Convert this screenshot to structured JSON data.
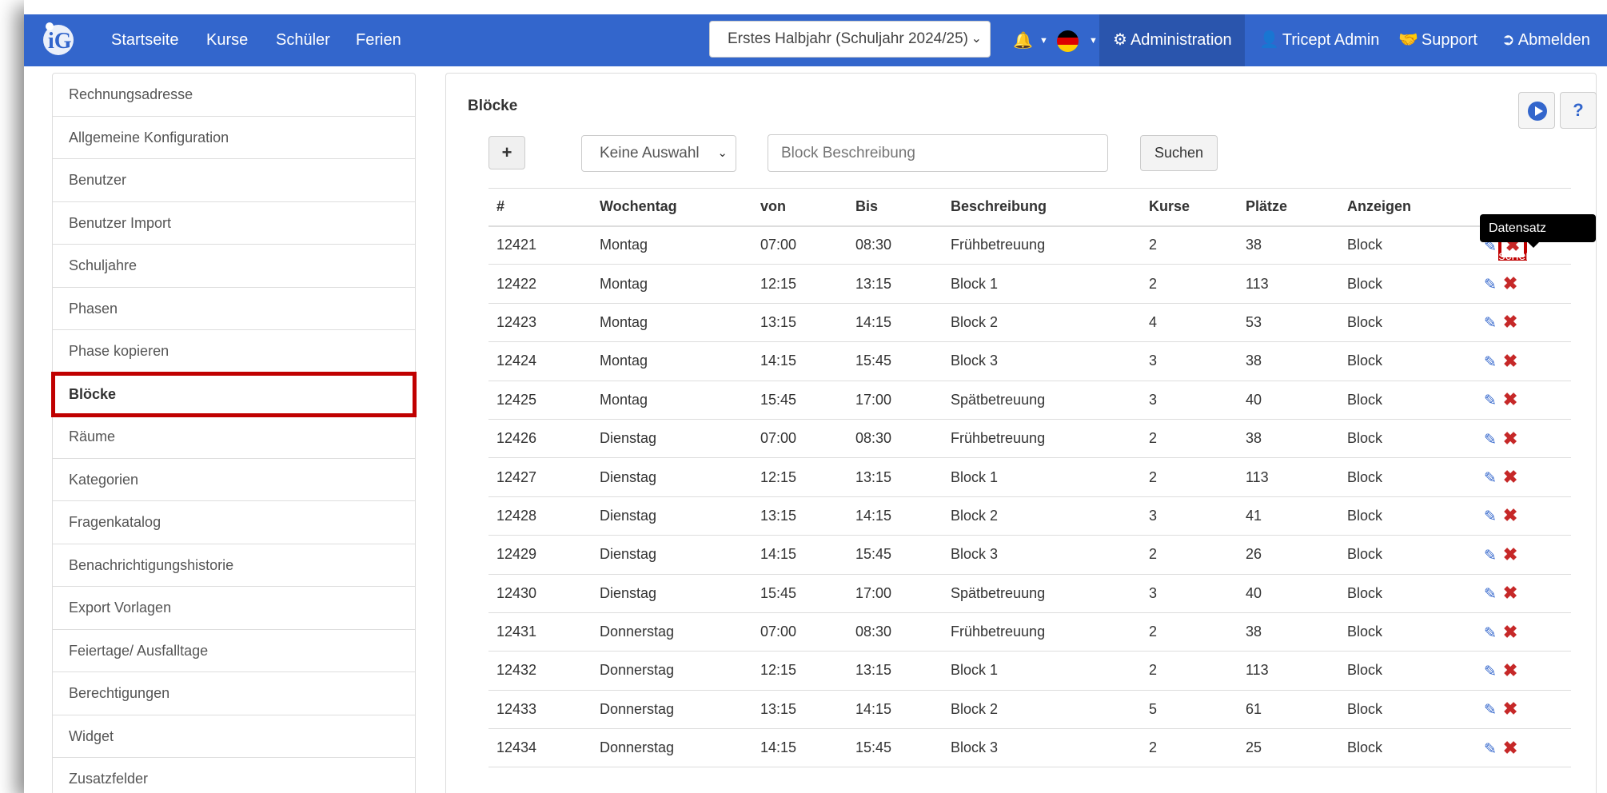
{
  "nav": {
    "links": [
      "Startseite",
      "Kurse",
      "Schüler",
      "Ferien"
    ],
    "term_select": "Erstes Halbjahr (Schuljahr 2024/25)",
    "administration": "Administration",
    "user": "Tricept Admin",
    "support": "Support",
    "logout": "Abmelden"
  },
  "sidebar": {
    "items": [
      "Rechnungsadresse",
      "Allgemeine Konfiguration",
      "Benutzer",
      "Benutzer Import",
      "Schuljahre",
      "Phasen",
      "Phase kopieren",
      "Blöcke",
      "Räume",
      "Kategorien",
      "Fragenkatalog",
      "Benachrichtigungshistorie",
      "Export Vorlagen",
      "Feiertage/ Ausfalltage",
      "Berechtigungen",
      "Widget",
      "Zusatzfelder"
    ],
    "active_index": 7
  },
  "main": {
    "title": "Blöcke",
    "add_label": "+",
    "filter_select": "Keine Auswahl",
    "search_placeholder": "Block Beschreibung",
    "search_button": "Suchen",
    "help_label": "?",
    "tooltip": "Datensatz löschen",
    "columns": [
      "#",
      "Wochentag",
      "von",
      "Bis",
      "Beschreibung",
      "Kurse",
      "Plätze",
      "Anzeigen",
      ""
    ],
    "rows": [
      [
        "12421",
        "Montag",
        "07:00",
        "08:30",
        "Frühbetreuung",
        "2",
        "38",
        "Block"
      ],
      [
        "12422",
        "Montag",
        "12:15",
        "13:15",
        "Block 1",
        "2",
        "113",
        "Block"
      ],
      [
        "12423",
        "Montag",
        "13:15",
        "14:15",
        "Block 2",
        "4",
        "53",
        "Block"
      ],
      [
        "12424",
        "Montag",
        "14:15",
        "15:45",
        "Block 3",
        "3",
        "38",
        "Block"
      ],
      [
        "12425",
        "Montag",
        "15:45",
        "17:00",
        "Spätbetreuung",
        "3",
        "40",
        "Block"
      ],
      [
        "12426",
        "Dienstag",
        "07:00",
        "08:30",
        "Frühbetreuung",
        "2",
        "38",
        "Block"
      ],
      [
        "12427",
        "Dienstag",
        "12:15",
        "13:15",
        "Block 1",
        "2",
        "113",
        "Block"
      ],
      [
        "12428",
        "Dienstag",
        "13:15",
        "14:15",
        "Block 2",
        "3",
        "41",
        "Block"
      ],
      [
        "12429",
        "Dienstag",
        "14:15",
        "15:45",
        "Block 3",
        "2",
        "26",
        "Block"
      ],
      [
        "12430",
        "Dienstag",
        "15:45",
        "17:00",
        "Spätbetreuung",
        "3",
        "40",
        "Block"
      ],
      [
        "12431",
        "Donnerstag",
        "07:00",
        "08:30",
        "Frühbetreuung",
        "2",
        "38",
        "Block"
      ],
      [
        "12432",
        "Donnerstag",
        "12:15",
        "13:15",
        "Block 1",
        "2",
        "113",
        "Block"
      ],
      [
        "12433",
        "Donnerstag",
        "13:15",
        "14:15",
        "Block 2",
        "5",
        "61",
        "Block"
      ],
      [
        "12434",
        "Donnerstag",
        "14:15",
        "15:45",
        "Block 3",
        "2",
        "25",
        "Block"
      ]
    ]
  },
  "colors": {
    "navbar": "#3366cc",
    "highlight": "#c00000",
    "delete": "#c62828"
  }
}
